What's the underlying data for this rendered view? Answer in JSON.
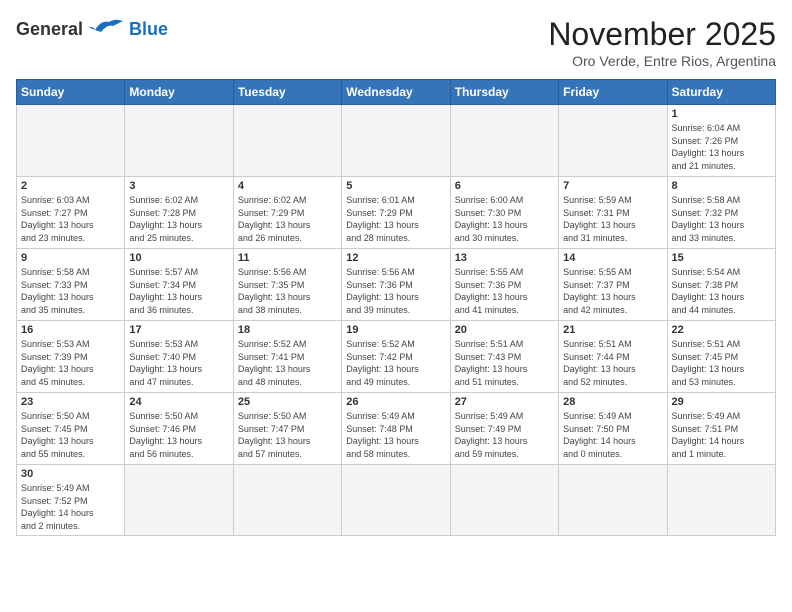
{
  "header": {
    "logo_general": "General",
    "logo_blue": "Blue",
    "month_title": "November 2025",
    "subtitle": "Oro Verde, Entre Rios, Argentina"
  },
  "days_of_week": [
    "Sunday",
    "Monday",
    "Tuesday",
    "Wednesday",
    "Thursday",
    "Friday",
    "Saturday"
  ],
  "weeks": [
    [
      {
        "day": "",
        "info": ""
      },
      {
        "day": "",
        "info": ""
      },
      {
        "day": "",
        "info": ""
      },
      {
        "day": "",
        "info": ""
      },
      {
        "day": "",
        "info": ""
      },
      {
        "day": "",
        "info": ""
      },
      {
        "day": "1",
        "info": "Sunrise: 6:04 AM\nSunset: 7:26 PM\nDaylight: 13 hours\nand 21 minutes."
      }
    ],
    [
      {
        "day": "2",
        "info": "Sunrise: 6:03 AM\nSunset: 7:27 PM\nDaylight: 13 hours\nand 23 minutes."
      },
      {
        "day": "3",
        "info": "Sunrise: 6:02 AM\nSunset: 7:28 PM\nDaylight: 13 hours\nand 25 minutes."
      },
      {
        "day": "4",
        "info": "Sunrise: 6:02 AM\nSunset: 7:29 PM\nDaylight: 13 hours\nand 26 minutes."
      },
      {
        "day": "5",
        "info": "Sunrise: 6:01 AM\nSunset: 7:29 PM\nDaylight: 13 hours\nand 28 minutes."
      },
      {
        "day": "6",
        "info": "Sunrise: 6:00 AM\nSunset: 7:30 PM\nDaylight: 13 hours\nand 30 minutes."
      },
      {
        "day": "7",
        "info": "Sunrise: 5:59 AM\nSunset: 7:31 PM\nDaylight: 13 hours\nand 31 minutes."
      },
      {
        "day": "8",
        "info": "Sunrise: 5:58 AM\nSunset: 7:32 PM\nDaylight: 13 hours\nand 33 minutes."
      }
    ],
    [
      {
        "day": "9",
        "info": "Sunrise: 5:58 AM\nSunset: 7:33 PM\nDaylight: 13 hours\nand 35 minutes."
      },
      {
        "day": "10",
        "info": "Sunrise: 5:57 AM\nSunset: 7:34 PM\nDaylight: 13 hours\nand 36 minutes."
      },
      {
        "day": "11",
        "info": "Sunrise: 5:56 AM\nSunset: 7:35 PM\nDaylight: 13 hours\nand 38 minutes."
      },
      {
        "day": "12",
        "info": "Sunrise: 5:56 AM\nSunset: 7:36 PM\nDaylight: 13 hours\nand 39 minutes."
      },
      {
        "day": "13",
        "info": "Sunrise: 5:55 AM\nSunset: 7:36 PM\nDaylight: 13 hours\nand 41 minutes."
      },
      {
        "day": "14",
        "info": "Sunrise: 5:55 AM\nSunset: 7:37 PM\nDaylight: 13 hours\nand 42 minutes."
      },
      {
        "day": "15",
        "info": "Sunrise: 5:54 AM\nSunset: 7:38 PM\nDaylight: 13 hours\nand 44 minutes."
      }
    ],
    [
      {
        "day": "16",
        "info": "Sunrise: 5:53 AM\nSunset: 7:39 PM\nDaylight: 13 hours\nand 45 minutes."
      },
      {
        "day": "17",
        "info": "Sunrise: 5:53 AM\nSunset: 7:40 PM\nDaylight: 13 hours\nand 47 minutes."
      },
      {
        "day": "18",
        "info": "Sunrise: 5:52 AM\nSunset: 7:41 PM\nDaylight: 13 hours\nand 48 minutes."
      },
      {
        "day": "19",
        "info": "Sunrise: 5:52 AM\nSunset: 7:42 PM\nDaylight: 13 hours\nand 49 minutes."
      },
      {
        "day": "20",
        "info": "Sunrise: 5:51 AM\nSunset: 7:43 PM\nDaylight: 13 hours\nand 51 minutes."
      },
      {
        "day": "21",
        "info": "Sunrise: 5:51 AM\nSunset: 7:44 PM\nDaylight: 13 hours\nand 52 minutes."
      },
      {
        "day": "22",
        "info": "Sunrise: 5:51 AM\nSunset: 7:45 PM\nDaylight: 13 hours\nand 53 minutes."
      }
    ],
    [
      {
        "day": "23",
        "info": "Sunrise: 5:50 AM\nSunset: 7:45 PM\nDaylight: 13 hours\nand 55 minutes."
      },
      {
        "day": "24",
        "info": "Sunrise: 5:50 AM\nSunset: 7:46 PM\nDaylight: 13 hours\nand 56 minutes."
      },
      {
        "day": "25",
        "info": "Sunrise: 5:50 AM\nSunset: 7:47 PM\nDaylight: 13 hours\nand 57 minutes."
      },
      {
        "day": "26",
        "info": "Sunrise: 5:49 AM\nSunset: 7:48 PM\nDaylight: 13 hours\nand 58 minutes."
      },
      {
        "day": "27",
        "info": "Sunrise: 5:49 AM\nSunset: 7:49 PM\nDaylight: 13 hours\nand 59 minutes."
      },
      {
        "day": "28",
        "info": "Sunrise: 5:49 AM\nSunset: 7:50 PM\nDaylight: 14 hours\nand 0 minutes."
      },
      {
        "day": "29",
        "info": "Sunrise: 5:49 AM\nSunset: 7:51 PM\nDaylight: 14 hours\nand 1 minute."
      }
    ],
    [
      {
        "day": "30",
        "info": "Sunrise: 5:49 AM\nSunset: 7:52 PM\nDaylight: 14 hours\nand 2 minutes."
      },
      {
        "day": "",
        "info": ""
      },
      {
        "day": "",
        "info": ""
      },
      {
        "day": "",
        "info": ""
      },
      {
        "day": "",
        "info": ""
      },
      {
        "day": "",
        "info": ""
      },
      {
        "day": "",
        "info": ""
      }
    ]
  ]
}
